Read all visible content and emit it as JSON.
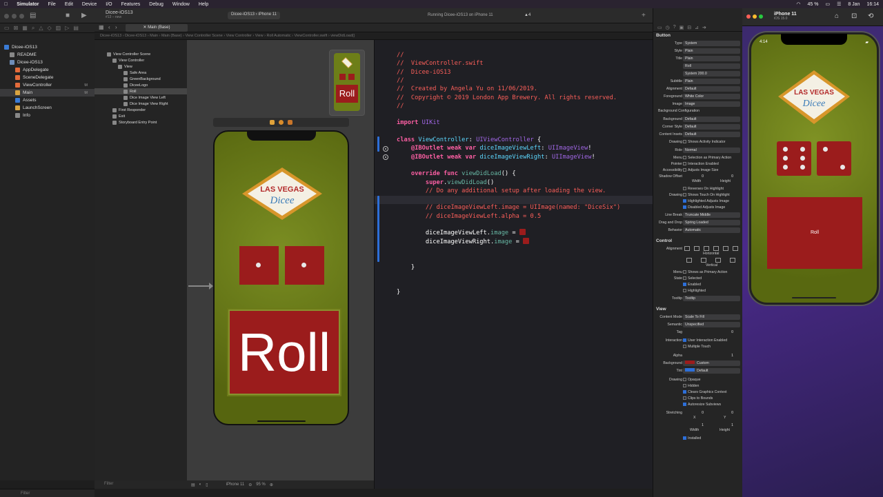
{
  "menubar": {
    "app": "Simulator",
    "items": [
      "File",
      "Edit",
      "Device",
      "I/O",
      "Features",
      "Debug",
      "Window",
      "Help"
    ],
    "battery": "45 %",
    "date": "8 Jan",
    "time": "16:14"
  },
  "toolbar": {
    "project_name": "Dicee-iOS13",
    "project_sub": "#13 – new",
    "scheme": "Dicee-iOS13",
    "device": "iPhone 11",
    "status": "Running Dicee-iOS13 on iPhone 11",
    "warnings": "4"
  },
  "editor": {
    "tab": "Main (Base)",
    "jumpbar": "Dicee-iOS13 › Dicee-iOS13 › Main › Main (Base) › View Controller Scene › View Controller › View › Roll          Automatic › ViewController.swift › viewDidLoad()"
  },
  "navigator": {
    "items": [
      {
        "label": "Dicee-iOS13",
        "badge": "",
        "indent": 0,
        "color": "#3a7bd5"
      },
      {
        "label": "README",
        "badge": "",
        "indent": 1,
        "color": "#888888"
      },
      {
        "label": "Dicee-iOS13",
        "badge": "",
        "indent": 1,
        "color": "#6e8db8"
      },
      {
        "label": "AppDelegate",
        "badge": "",
        "indent": 2,
        "color": "#e36b3b"
      },
      {
        "label": "SceneDelegate",
        "badge": "",
        "indent": 2,
        "color": "#e36b3b"
      },
      {
        "label": "ViewController",
        "badge": "M",
        "indent": 2,
        "color": "#e36b3b"
      },
      {
        "label": "Main",
        "badge": "M",
        "indent": 2,
        "color": "#d9a441",
        "selected": true
      },
      {
        "label": "Assets",
        "badge": "",
        "indent": 2,
        "color": "#3a7bd5"
      },
      {
        "label": "LaunchScreen",
        "badge": "",
        "indent": 2,
        "color": "#d9a441"
      },
      {
        "label": "Info",
        "badge": "",
        "indent": 2,
        "color": "#888888"
      }
    ],
    "filter_placeholder": "Filter"
  },
  "outline": {
    "items": [
      {
        "label": "View Controller Scene",
        "indent": 0
      },
      {
        "label": "View Controller",
        "indent": 1
      },
      {
        "label": "View",
        "indent": 2
      },
      {
        "label": "Safe Area",
        "indent": 3
      },
      {
        "label": "GreenBackground",
        "indent": 3
      },
      {
        "label": "DiceeLogo",
        "indent": 3
      },
      {
        "label": "Roll",
        "indent": 3,
        "selected": true
      },
      {
        "label": "Dice Image View Left",
        "indent": 3
      },
      {
        "label": "Dice Image View Right",
        "indent": 3
      },
      {
        "label": "First Responder",
        "indent": 1
      },
      {
        "label": "Exit",
        "indent": 1
      },
      {
        "label": "Storyboard Entry Point",
        "indent": 1
      }
    ],
    "filter_placeholder": "Filter"
  },
  "canvas": {
    "logo_top": "LAS VEGAS",
    "logo_bottom": "Dicee",
    "button_title": "Roll",
    "device": "iPhone 11",
    "zoom": "95 %"
  },
  "code": {
    "lines": [
      "//",
      "//  ViewController.swift",
      "//  Dicee-iOS13",
      "//",
      "//  Created by Angela Yu on 11/06/2019.",
      "//  Copyright © 2019 London App Brewery. All rights reserved.",
      "//",
      "",
      "import UIKit",
      "",
      "class ViewController: UIViewController {",
      "    @IBOutlet weak var diceImageViewLeft: UIImageView!",
      "    @IBOutlet weak var diceImageViewRight: UIImageView!",
      "",
      "    override func viewDidLoad() {",
      "        super.viewDidLoad()",
      "        // Do any additional setup after loading the view.",
      "",
      "        // diceImageViewLeft.image = UIImage(named: \"DiceSix\")",
      "        // diceImageViewLeft.alpha = 0.5",
      "",
      "        diceImageViewLeft.image = ",
      "        diceImageViewRight.image = ",
      "",
      "",
      "    }",
      "",
      "",
      "}"
    ]
  },
  "inspector": {
    "button_header": "Button",
    "rows1": [
      {
        "label": "Type",
        "value": "System"
      },
      {
        "label": "Style",
        "value": "Plain"
      },
      {
        "label": "Title",
        "value": "Plain"
      },
      {
        "label": "",
        "value": "Roll"
      },
      {
        "label": "",
        "value": "System 200.0"
      },
      {
        "label": "Subtitle",
        "value": "Plain"
      },
      {
        "label": "Alignment",
        "value": "Default"
      },
      {
        "label": "Foreground",
        "value": "White Color"
      },
      {
        "label": "Image",
        "value": "Image"
      }
    ],
    "bg_config": "Background Configuration",
    "rows2": [
      {
        "label": "Background",
        "value": "Default"
      },
      {
        "label": "Corner Style",
        "value": "Default"
      },
      {
        "label": "Content Insets",
        "value": "Default"
      }
    ],
    "checks1": [
      {
        "label": "Drawing",
        "text": "Shows Activity Indicator",
        "on": false
      }
    ],
    "role": {
      "label": "Role",
      "value": "Normal"
    },
    "checks2": [
      {
        "label": "Menu",
        "text": "Selection as Primary Action",
        "on": false
      },
      {
        "label": "Pointer",
        "text": "Interaction Enabled",
        "on": false
      },
      {
        "label": "Accessibility",
        "text": "Adjusts Image Size",
        "on": false
      }
    ],
    "shadow_offset": {
      "label": "Shadow Offset",
      "w": "0",
      "h": "0",
      "wl": "Width",
      "hl": "Height"
    },
    "checks3": [
      {
        "label": "",
        "text": "Reverses On Highlight",
        "on": false
      },
      {
        "label": "Drawing",
        "text": "Shows Touch On Highlight",
        "on": false
      },
      {
        "label": "",
        "text": "Highlighted Adjusts Image",
        "on": true
      },
      {
        "label": "",
        "text": "Disabled Adjusts Image",
        "on": true
      }
    ],
    "rows3": [
      {
        "label": "Line Break",
        "value": "Truncate Middle"
      },
      {
        "label": "Drag and Drop",
        "value": "Spring Loaded"
      },
      {
        "label": "Behavior",
        "value": "Automatic"
      }
    ],
    "control_header": "Control",
    "alignment_label": "Alignment",
    "horizontal": "Horizontal",
    "vertical": "Vertical",
    "checks4": [
      {
        "label": "Menu",
        "text": "Shows as Primary Action",
        "on": false
      },
      {
        "label": "State",
        "text": "Selected",
        "on": false
      },
      {
        "label": "",
        "text": "Enabled",
        "on": true
      },
      {
        "label": "",
        "text": "Highlighted",
        "on": false
      }
    ],
    "tooltip": {
      "label": "Tooltip",
      "value": "Tooltip"
    },
    "view_header": "View",
    "rows4": [
      {
        "label": "Content Mode",
        "value": "Scale To Fill"
      },
      {
        "label": "Semantic",
        "value": "Unspecified"
      }
    ],
    "tag": {
      "label": "Tag",
      "value": "0"
    },
    "checks5": [
      {
        "label": "Interaction",
        "text": "User Interaction Enabled",
        "on": true
      },
      {
        "label": "",
        "text": "Multiple Touch",
        "on": false
      }
    ],
    "alpha": {
      "label": "Alpha",
      "value": "1"
    },
    "background": {
      "label": "Background",
      "value": "Custom",
      "color": "#9b1c1c"
    },
    "tint": {
      "label": "Tint",
      "value": "Default",
      "color": "#2d6fd8"
    },
    "checks6": [
      {
        "label": "Drawing",
        "text": "Opaque",
        "on": false
      },
      {
        "label": "",
        "text": "Hidden",
        "on": false
      },
      {
        "label": "",
        "text": "Clears Graphics Context",
        "on": true
      },
      {
        "label": "",
        "text": "Clips to Bounds",
        "on": false
      },
      {
        "label": "",
        "text": "Autoresize Subviews",
        "on": true
      }
    ],
    "stretching": {
      "label": "Stretching",
      "x": "0",
      "y": "0",
      "w": "1",
      "h": "1",
      "xl": "X",
      "yl": "Y",
      "wl": "Width",
      "hl": "Height"
    },
    "installed": {
      "text": "Installed",
      "on": true
    }
  },
  "simulator": {
    "device": "iPhone 11",
    "os": "iOS 15.0",
    "time": "4:14",
    "logo_top": "LAS VEGAS",
    "logo_bottom": "Dicee",
    "button_title": "Roll"
  }
}
